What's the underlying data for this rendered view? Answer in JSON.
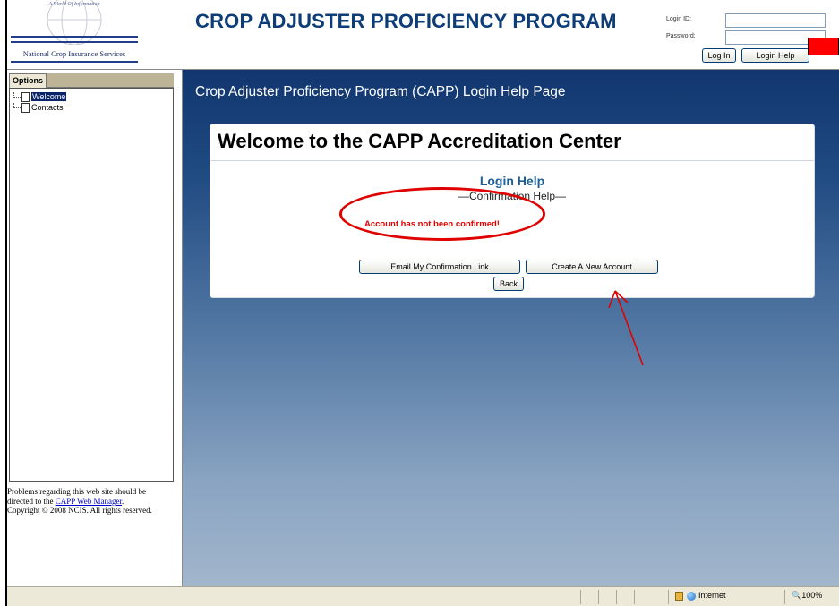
{
  "header": {
    "logo_tagline": "A World Of Information",
    "logo_name": "National Crop Insurance Services",
    "title": "CROP ADJUSTER PROFICIENCY PROGRAM",
    "login_id_label": "Login ID:",
    "password_label": "Password:",
    "login_button": "Log In",
    "login_help_button": "Login Help"
  },
  "sidebar": {
    "tab_label": "Options",
    "items": [
      {
        "label": "Welcome",
        "selected": true
      },
      {
        "label": "Contacts",
        "selected": false
      }
    ],
    "footer_prefix": "Problems regarding this web site should be directed to the ",
    "footer_link": "CAPP Web Manager",
    "footer_suffix": ".",
    "copyright": "Copyright © 2008 NCIS. All rights reserved."
  },
  "main": {
    "page_heading": "Crop Adjuster Proficiency Program (CAPP) Login Help Page",
    "card_title": "Welcome to the CAPP Accreditation Center",
    "login_help": "Login Help",
    "confirmation_help": "—Confirmation Help—",
    "error": "Account has not been confirmed!",
    "email_button": "Email My Confirmation Link",
    "create_button": "Create A New Account",
    "back_button": "Back"
  },
  "statusbar": {
    "zone": "Internet",
    "zoom": "100%"
  },
  "colors": {
    "title_blue": "#0d3d78",
    "error_red": "#e00000",
    "annotation_red": "#e00000",
    "link_blue": "#1a5f9a"
  }
}
